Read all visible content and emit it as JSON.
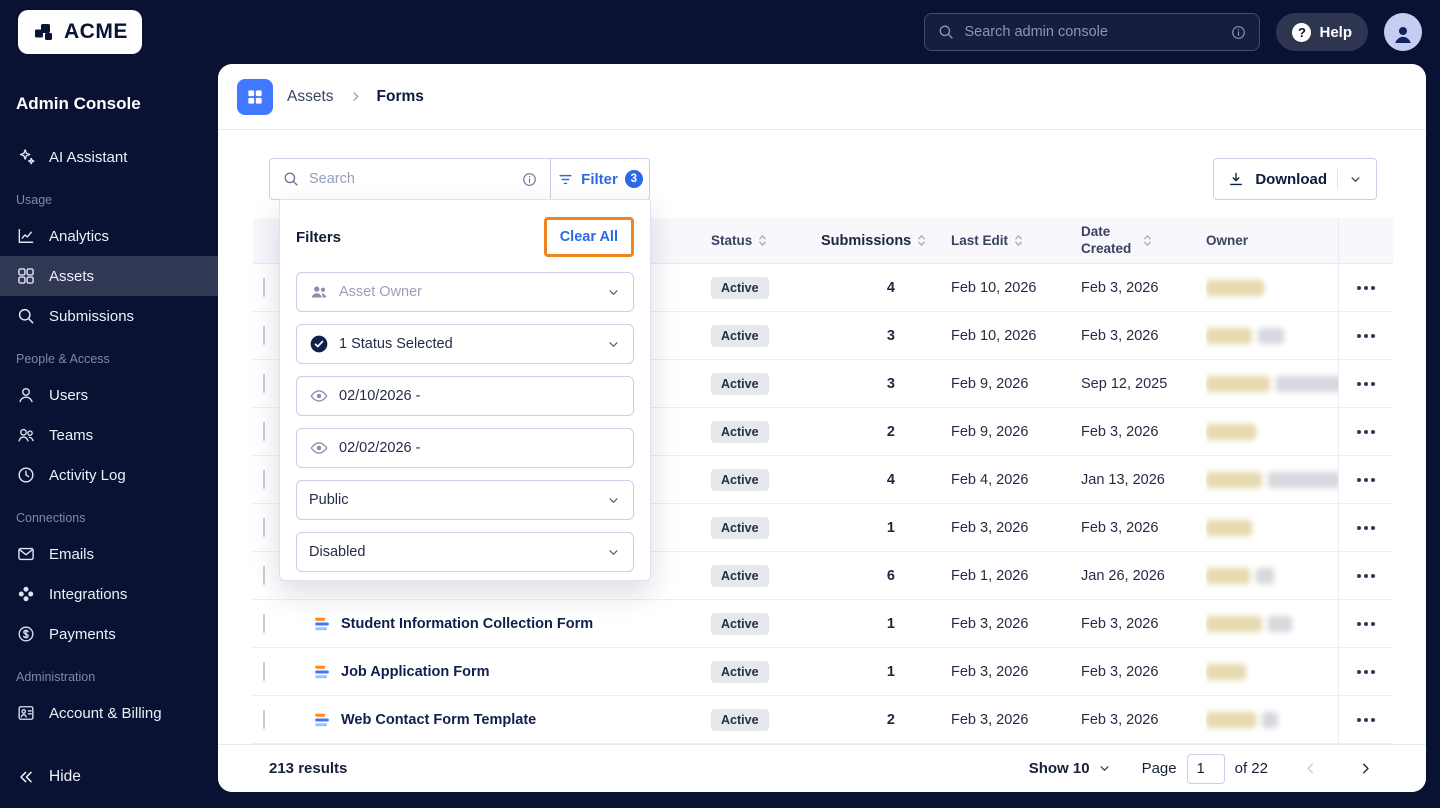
{
  "topbar": {
    "logo_text": "ACME",
    "search_placeholder": "Search admin console",
    "help_label": "Help"
  },
  "sidebar": {
    "title": "Admin Console",
    "hide_label": "Hide",
    "sections": [
      {
        "label": null,
        "items": [
          {
            "label": "AI Assistant",
            "icon": "sparkles",
            "active": false
          }
        ]
      },
      {
        "label": "Usage",
        "items": [
          {
            "label": "Analytics",
            "icon": "chart",
            "active": false
          },
          {
            "label": "Assets",
            "icon": "grid",
            "active": true
          },
          {
            "label": "Submissions",
            "icon": "search",
            "active": false
          }
        ]
      },
      {
        "label": "People & Access",
        "items": [
          {
            "label": "Users",
            "icon": "user",
            "active": false
          },
          {
            "label": "Teams",
            "icon": "users",
            "active": false
          },
          {
            "label": "Activity Log",
            "icon": "clock",
            "active": false
          }
        ]
      },
      {
        "label": "Connections",
        "items": [
          {
            "label": "Emails",
            "icon": "mail",
            "active": false
          },
          {
            "label": "Integrations",
            "icon": "integrations",
            "active": false
          },
          {
            "label": "Payments",
            "icon": "dollar",
            "active": false
          }
        ]
      },
      {
        "label": "Administration",
        "items": [
          {
            "label": "Account & Billing",
            "icon": "badge",
            "active": false
          }
        ]
      }
    ]
  },
  "breadcrumb": {
    "section": "Assets",
    "current": "Forms"
  },
  "toolbar": {
    "search_placeholder": "Search",
    "filter_label": "Filter",
    "filter_count": "3",
    "download_label": "Download"
  },
  "filters_panel": {
    "title": "Filters",
    "clear_all_label": "Clear All",
    "controls": [
      {
        "icon": "people",
        "text": "Asset Owner",
        "muted": true,
        "chevron": true
      },
      {
        "icon": "check-circle",
        "text": "1 Status Selected",
        "muted": false,
        "chevron": true
      },
      {
        "icon": "eye",
        "text": "02/10/2026 -",
        "muted": false,
        "chevron": false
      },
      {
        "icon": "eye",
        "text": "02/02/2026 -",
        "muted": false,
        "chevron": false
      },
      {
        "icon": null,
        "text": "Public",
        "muted": false,
        "chevron": true
      },
      {
        "icon": null,
        "text": "Disabled",
        "muted": false,
        "chevron": true
      }
    ]
  },
  "table": {
    "headers": {
      "status": "Status",
      "submissions": "Submissions",
      "last_edit": "Last Edit",
      "date_created": "Date Created",
      "owner": "Owner"
    },
    "rows": [
      {
        "name": "",
        "status": "Active",
        "submissions": "4",
        "last_edit": "Feb 10, 2026",
        "date_created": "Feb 3, 2026",
        "owner_redacted": true
      },
      {
        "name": "",
        "status": "Active",
        "submissions": "3",
        "last_edit": "Feb 10, 2026",
        "date_created": "Feb 3, 2026",
        "owner_redacted": true
      },
      {
        "name": "",
        "status": "Active",
        "submissions": "3",
        "last_edit": "Feb 9, 2026",
        "date_created": "Sep 12, 2025",
        "owner_redacted": true
      },
      {
        "name": "",
        "status": "Active",
        "submissions": "2",
        "last_edit": "Feb 9, 2026",
        "date_created": "Feb 3, 2026",
        "owner_redacted": true
      },
      {
        "name": "",
        "status": "Active",
        "submissions": "4",
        "last_edit": "Feb 4, 2026",
        "date_created": "Jan 13, 2026",
        "owner_redacted": true
      },
      {
        "name": "",
        "status": "Active",
        "submissions": "1",
        "last_edit": "Feb 3, 2026",
        "date_created": "Feb 3, 2026",
        "owner_redacted": true
      },
      {
        "name": "",
        "status": "Active",
        "submissions": "6",
        "last_edit": "Feb 1, 2026",
        "date_created": "Jan 26, 2026",
        "owner_redacted": true
      },
      {
        "name": "Student Information Collection Form",
        "status": "Active",
        "submissions": "1",
        "last_edit": "Feb 3, 2026",
        "date_created": "Feb 3, 2026",
        "owner_redacted": true
      },
      {
        "name": "Job Application Form",
        "status": "Active",
        "submissions": "1",
        "last_edit": "Feb 3, 2026",
        "date_created": "Feb 3, 2026",
        "owner_redacted": true
      },
      {
        "name": "Web Contact Form Template",
        "status": "Active",
        "submissions": "2",
        "last_edit": "Feb 3, 2026",
        "date_created": "Feb 3, 2026",
        "owner_redacted": true
      }
    ]
  },
  "footer": {
    "results": "213 results",
    "show_label": "Show 10",
    "page_label": "Page",
    "page_value": "1",
    "of_label": "of 22"
  },
  "colors": {
    "navy": "#0a1233",
    "accent_blue": "#2e69e5",
    "breadcrumb_icon_blue": "#4277ff",
    "annotation_orange": "#ee8420",
    "status_pill_bg": "#e6e8ec"
  }
}
